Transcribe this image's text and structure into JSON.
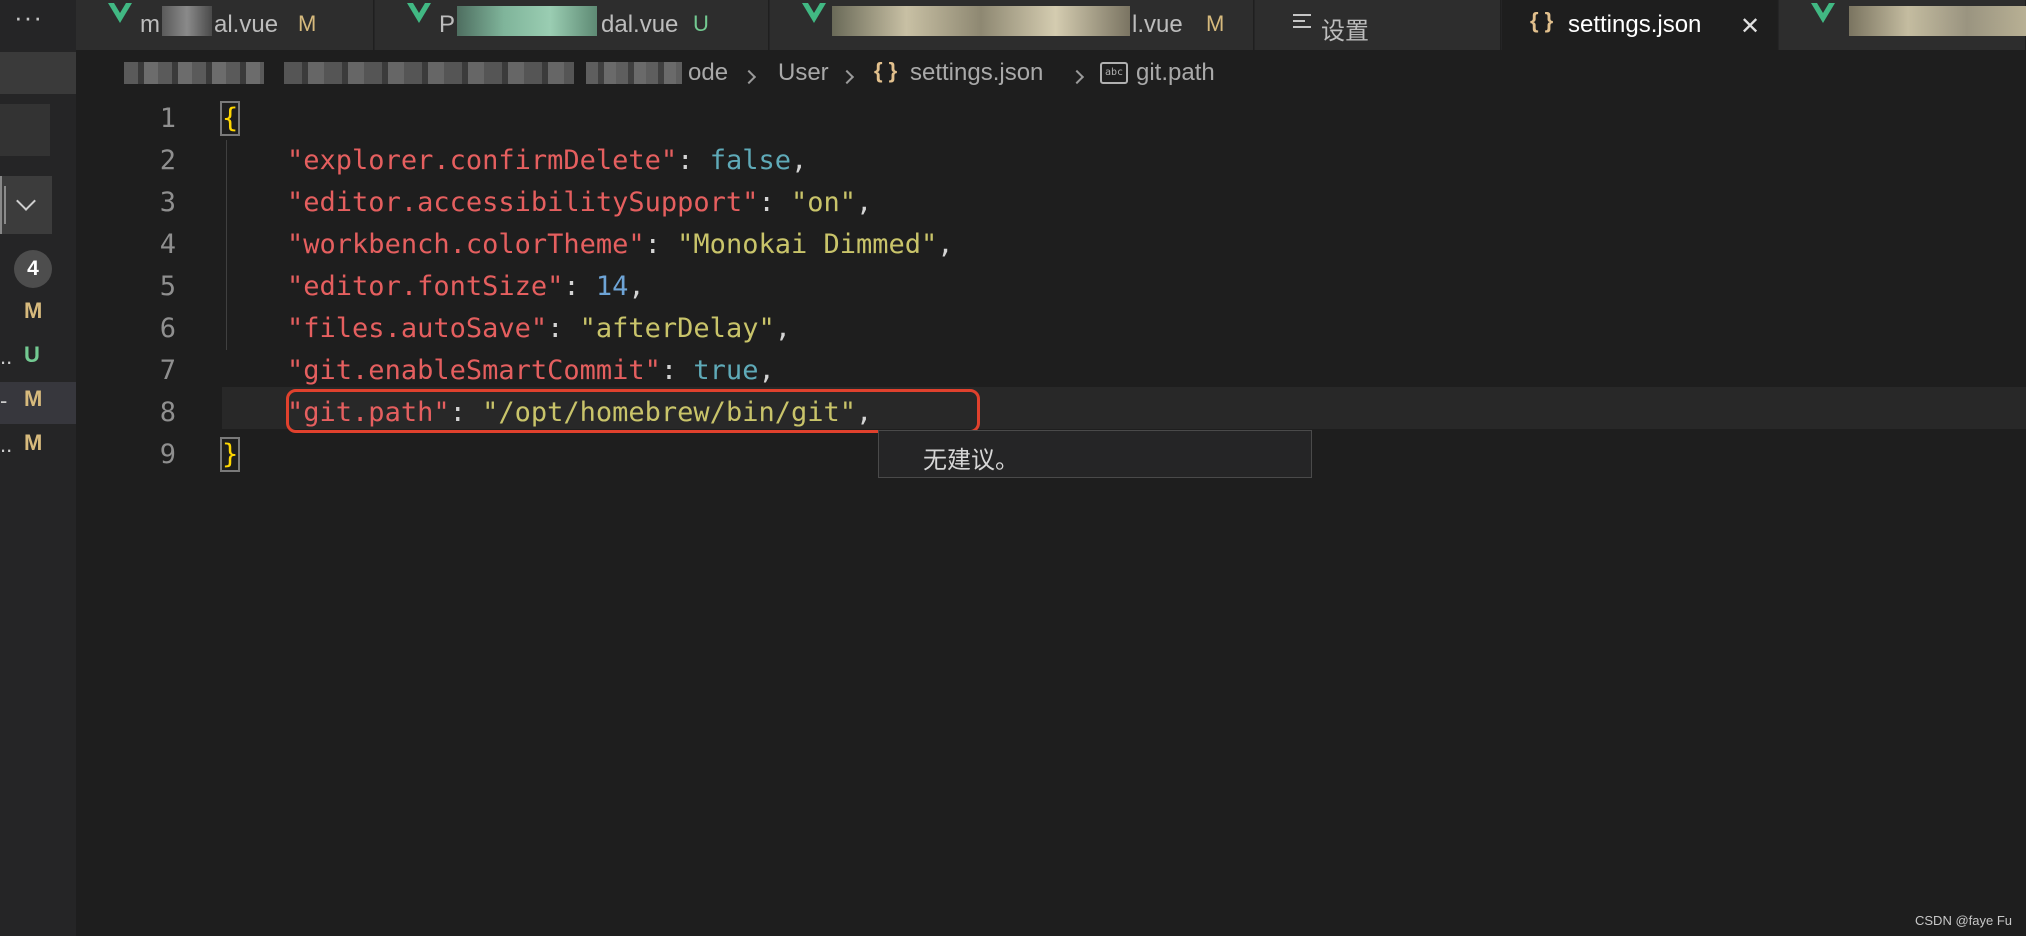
{
  "sidebar": {
    "more_label": "···",
    "count_badge": "4",
    "rows": [
      {
        "prefix": "",
        "status": "M"
      },
      {
        "prefix": "..",
        "status": "U"
      },
      {
        "prefix": "-",
        "status": "M"
      },
      {
        "prefix": "..",
        "status": "M"
      }
    ]
  },
  "tabs": [
    {
      "prefix": "m",
      "suffix": "al.vue",
      "status": "M"
    },
    {
      "prefix": "P",
      "suffix": "dal.vue",
      "status": "U"
    },
    {
      "prefix": "",
      "suffix": "l.vue",
      "status": "M"
    },
    {
      "label": "设置"
    },
    {
      "label": "settings.json",
      "active": true,
      "close": "✕"
    }
  ],
  "breadcrumb": {
    "partial": "ode",
    "user": "User",
    "file": "settings.json",
    "file_icon": "{ }",
    "symbol_icon": "abc",
    "symbol": "git.path"
  },
  "editor": {
    "line_numbers": [
      "1",
      "2",
      "3",
      "4",
      "5",
      "6",
      "7",
      "8",
      "9"
    ],
    "open_brace": "{",
    "close_brace": "}",
    "lines": [
      {
        "key": "\"explorer.confirmDelete\"",
        "value": "false",
        "type": "bool"
      },
      {
        "key": "\"editor.accessibilitySupport\"",
        "value": "\"on\"",
        "type": "string"
      },
      {
        "key": "\"workbench.colorTheme\"",
        "value": "\"Monokai Dimmed\"",
        "type": "string"
      },
      {
        "key": "\"editor.fontSize\"",
        "value": "14",
        "type": "number"
      },
      {
        "key": "\"files.autoSave\"",
        "value": "\"afterDelay\"",
        "type": "string"
      },
      {
        "key": "\"git.enableSmartCommit\"",
        "value": "true",
        "type": "bool"
      },
      {
        "key": "\"git.path\"",
        "value": "\"/opt/homebrew/bin/git\"",
        "type": "string"
      }
    ],
    "colon": ": ",
    "comma": ",",
    "suggestion": "无建议。"
  },
  "watermark": "CSDN @faye Fu",
  "colors": {
    "background": "#1e1e1e",
    "key": "#e55f5f",
    "string": "#c9c46a",
    "boolean": "#5faab8",
    "number": "#6ea4d6",
    "highlight_box": "#e0412d"
  }
}
